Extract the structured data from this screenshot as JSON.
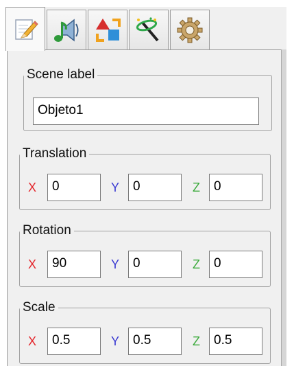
{
  "tabs": [
    {
      "name": "edit-tab",
      "icon": "pencil-icon",
      "active": true
    },
    {
      "name": "sound-tab",
      "icon": "music-speaker-icon",
      "active": false
    },
    {
      "name": "shapes-tab",
      "icon": "shapes-icon",
      "active": false
    },
    {
      "name": "magic-tab",
      "icon": "magic-wand-icon",
      "active": false
    },
    {
      "name": "settings-tab",
      "icon": "gear-icon",
      "active": false
    }
  ],
  "scene": {
    "legend": "Scene label",
    "value": "Objeto1"
  },
  "translation": {
    "legend": "Translation",
    "x_label": "X",
    "x": "0",
    "y_label": "Y",
    "y": "0",
    "z_label": "Z",
    "z": "0"
  },
  "rotation": {
    "legend": "Rotation",
    "x_label": "X",
    "x": "90",
    "y_label": "Y",
    "y": "0",
    "z_label": "Z",
    "z": "0"
  },
  "scale": {
    "legend": "Scale",
    "x_label": "X",
    "x": "0.5",
    "y_label": "Y",
    "y": "0.5",
    "z_label": "Z",
    "z": "0.5"
  },
  "colors": {
    "axis_x": "#e4262c",
    "axis_y": "#3a3ad2",
    "axis_z": "#3aaa3a",
    "panel_bg": "#f0f0f0"
  }
}
